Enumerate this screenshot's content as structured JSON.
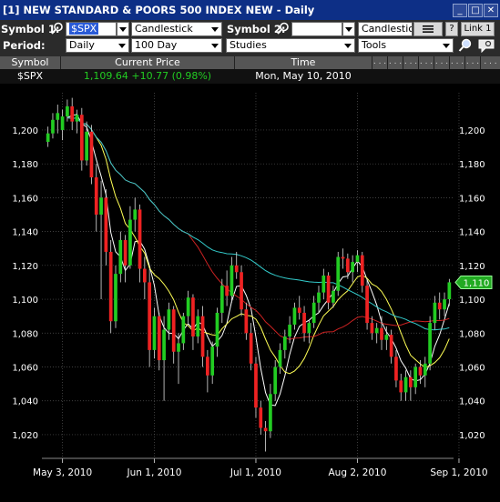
{
  "window": {
    "title": "[1] NEW STANDARD & POORS 500 INDEX NEW - Daily",
    "buttons": [
      "_",
      "□",
      "✕"
    ]
  },
  "toolbar": {
    "symbol1_label": "Symbol 1:",
    "symbol1_value": "$SPX",
    "chart_type1": "Candlestick",
    "symbol2_label": "Symbol 2:",
    "symbol2_value": "",
    "chart_type2": "Candlestick",
    "help_label": "?",
    "link_label": "Link 1",
    "period_label": "Period:",
    "period_value": "Daily",
    "range_value": "100 Day",
    "studies_value": "Studies",
    "tools_value": "Tools"
  },
  "quote": {
    "headers": [
      "Symbol",
      "Current Price",
      "Time"
    ],
    "symbol": "$SPX",
    "price": "1,109.64 +10.77 (0.98%)",
    "time": "Mon, May 10, 2010",
    "dots": ". . ."
  },
  "colors": {
    "up": "#22cc22",
    "down": "#ee2222",
    "ma_fast": "#ffffff",
    "ma_mid": "#ffff55",
    "ma_red": "#cc2222",
    "ma_cyan": "#33cccc",
    "price_tag": "#22aa22"
  },
  "chart_data": {
    "type": "candlestick",
    "y_ticks": [
      1020,
      1040,
      1060,
      1080,
      1100,
      1120,
      1140,
      1160,
      1180,
      1200
    ],
    "y_tick_labels": [
      "1,020",
      "1,040",
      "1,060",
      "1,080",
      "1,100",
      "1,120",
      "1,140",
      "1,160",
      "1,180",
      "1,200"
    ],
    "ylim": [
      1006,
      1222
    ],
    "x_tick_labels": [
      "May 3, 2010",
      "Jun 1, 2010",
      "Jul 1, 2010",
      "Aug 2, 2010",
      "Sep 1, 2010"
    ],
    "x_tick_index": [
      3,
      22,
      43,
      64,
      85
    ],
    "current_price_label": "1,110",
    "current_price": 1110,
    "grid": true,
    "candles": [
      [
        1193,
        1202,
        1190,
        1198
      ],
      [
        1198,
        1210,
        1195,
        1206
      ],
      [
        1206,
        1215,
        1198,
        1210
      ],
      [
        1200,
        1212,
        1194,
        1208
      ],
      [
        1208,
        1218,
        1205,
        1214
      ],
      [
        1214,
        1219,
        1200,
        1205
      ],
      [
        1205,
        1212,
        1198,
        1209
      ],
      [
        1209,
        1213,
        1176,
        1182
      ],
      [
        1182,
        1205,
        1179,
        1199
      ],
      [
        1199,
        1203,
        1168,
        1172
      ],
      [
        1172,
        1180,
        1140,
        1150
      ],
      [
        1150,
        1170,
        1100,
        1160
      ],
      [
        1160,
        1165,
        1120,
        1128
      ],
      [
        1128,
        1135,
        1080,
        1087
      ],
      [
        1087,
        1120,
        1083,
        1115
      ],
      [
        1115,
        1140,
        1110,
        1135
      ],
      [
        1135,
        1138,
        1110,
        1120
      ],
      [
        1120,
        1155,
        1118,
        1147
      ],
      [
        1147,
        1160,
        1140,
        1153
      ],
      [
        1153,
        1156,
        1110,
        1118
      ],
      [
        1118,
        1125,
        1100,
        1110
      ],
      [
        1110,
        1118,
        1060,
        1070
      ],
      [
        1070,
        1095,
        1065,
        1090
      ],
      [
        1090,
        1092,
        1058,
        1064
      ],
      [
        1064,
        1090,
        1040,
        1082
      ],
      [
        1082,
        1098,
        1076,
        1094
      ],
      [
        1094,
        1096,
        1062,
        1069
      ],
      [
        1069,
        1080,
        1050,
        1074
      ],
      [
        1074,
        1092,
        1070,
        1090
      ],
      [
        1090,
        1105,
        1086,
        1101
      ],
      [
        1101,
        1103,
        1070,
        1078
      ],
      [
        1078,
        1094,
        1074,
        1090
      ],
      [
        1090,
        1096,
        1060,
        1066
      ],
      [
        1066,
        1070,
        1045,
        1055
      ],
      [
        1055,
        1075,
        1050,
        1072
      ],
      [
        1072,
        1095,
        1066,
        1092
      ],
      [
        1092,
        1112,
        1086,
        1108
      ],
      [
        1108,
        1117,
        1096,
        1102
      ],
      [
        1102,
        1125,
        1098,
        1120
      ],
      [
        1120,
        1128,
        1112,
        1116
      ],
      [
        1116,
        1120,
        1090,
        1094
      ],
      [
        1094,
        1098,
        1076,
        1080
      ],
      [
        1080,
        1086,
        1058,
        1062
      ],
      [
        1062,
        1066,
        1030,
        1036
      ],
      [
        1036,
        1040,
        1020,
        1024
      ],
      [
        1024,
        1028,
        1010,
        1022
      ],
      [
        1022,
        1050,
        1018,
        1044
      ],
      [
        1044,
        1064,
        1040,
        1060
      ],
      [
        1060,
        1074,
        1056,
        1070
      ],
      [
        1070,
        1082,
        1065,
        1078
      ],
      [
        1078,
        1090,
        1074,
        1085
      ],
      [
        1085,
        1098,
        1082,
        1095
      ],
      [
        1095,
        1102,
        1088,
        1092
      ],
      [
        1092,
        1096,
        1075,
        1080
      ],
      [
        1080,
        1088,
        1074,
        1086
      ],
      [
        1086,
        1102,
        1083,
        1098
      ],
      [
        1098,
        1108,
        1092,
        1104
      ],
      [
        1104,
        1118,
        1100,
        1114
      ],
      [
        1114,
        1116,
        1094,
        1098
      ],
      [
        1098,
        1108,
        1095,
        1105
      ],
      [
        1105,
        1128,
        1102,
        1125
      ],
      [
        1125,
        1130,
        1118,
        1124
      ],
      [
        1124,
        1127,
        1112,
        1116
      ],
      [
        1116,
        1126,
        1110,
        1122
      ],
      [
        1122,
        1129,
        1116,
        1126
      ],
      [
        1126,
        1128,
        1104,
        1108
      ],
      [
        1108,
        1112,
        1082,
        1086
      ],
      [
        1086,
        1090,
        1076,
        1080
      ],
      [
        1080,
        1086,
        1074,
        1083
      ],
      [
        1083,
        1090,
        1070,
        1076
      ],
      [
        1076,
        1084,
        1070,
        1079
      ],
      [
        1079,
        1082,
        1062,
        1066
      ],
      [
        1066,
        1070,
        1048,
        1052
      ],
      [
        1052,
        1056,
        1040,
        1045
      ],
      [
        1045,
        1058,
        1040,
        1054
      ],
      [
        1054,
        1058,
        1040,
        1048
      ],
      [
        1048,
        1062,
        1044,
        1060
      ],
      [
        1060,
        1064,
        1050,
        1055
      ],
      [
        1055,
        1066,
        1048,
        1062
      ],
      [
        1062,
        1090,
        1058,
        1086
      ],
      [
        1086,
        1102,
        1082,
        1098
      ],
      [
        1098,
        1104,
        1088,
        1094
      ],
      [
        1094,
        1104,
        1090,
        1100
      ],
      [
        1100,
        1112,
        1096,
        1110
      ]
    ]
  }
}
